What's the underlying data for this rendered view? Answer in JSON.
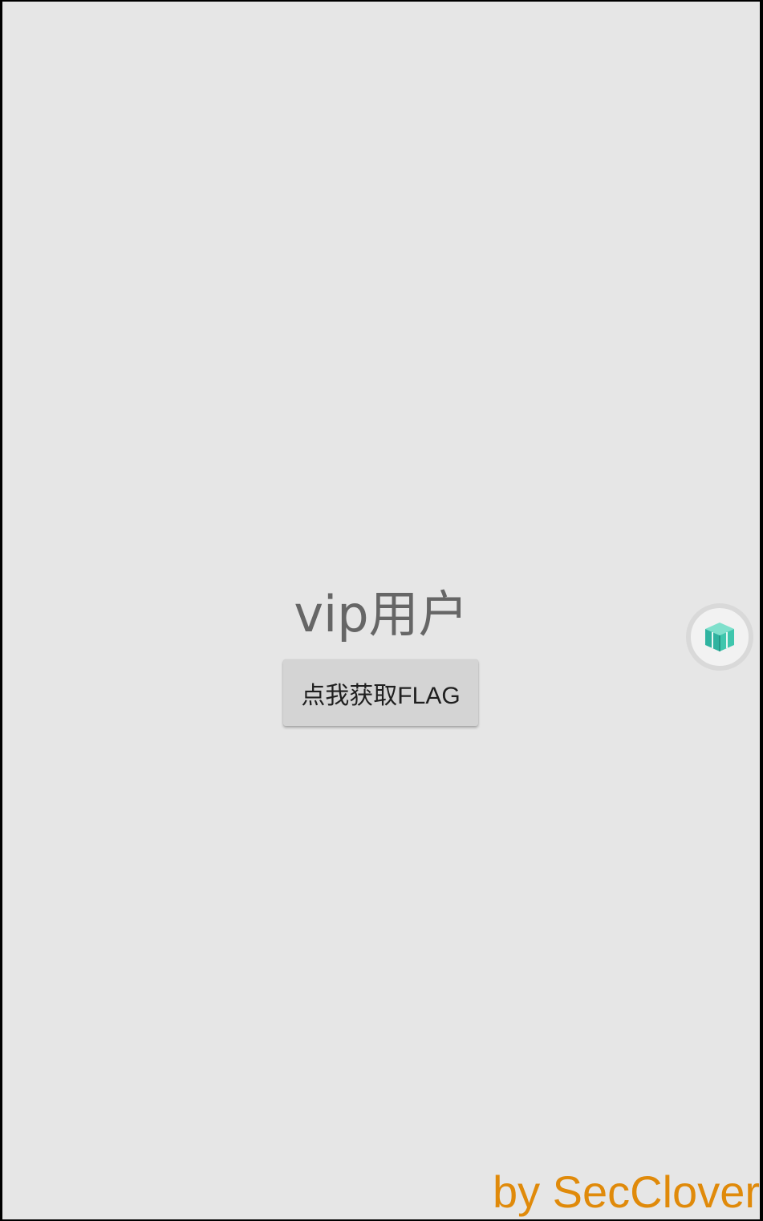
{
  "screen": {
    "title": "vip用户",
    "button_label": "点我获取FLAG"
  },
  "floating_ball": {
    "icon": "cube-icon"
  },
  "watermark": {
    "text": "by SecClover"
  },
  "colors": {
    "background": "#e6e6e6",
    "title": "#666666",
    "button": "#d4d4d4",
    "watermark": "#e08a0a",
    "icon_accent": "#3cc3a8"
  }
}
